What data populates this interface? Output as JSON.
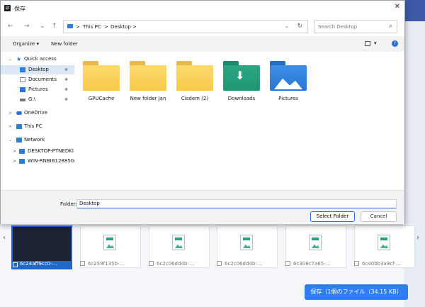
{
  "dialog": {
    "title": "保存",
    "close_glyph": "✕",
    "nav": {
      "back": "←",
      "forward": "→",
      "recent": "⌄",
      "up": "↑"
    },
    "address": {
      "sep1": ">",
      "crumb1": "This PC",
      "sep2": ">",
      "crumb2": "Desktop",
      "sep3": ">",
      "dropdown": "⌄",
      "refresh": "↻"
    },
    "search_placeholder": "Search Desktop",
    "search_icon": "⌕",
    "toolbar": {
      "organize": "Organize ▾",
      "new_folder": "New folder",
      "view_dd": "▾",
      "help": "?"
    },
    "sidebar": [
      {
        "id": "quick-access",
        "chev": "⌄",
        "label": "Quick access",
        "icon": "star-icon"
      },
      {
        "id": "desktop",
        "label": "Desktop",
        "pin": "✱",
        "icon": "desktop-icon"
      },
      {
        "id": "documents",
        "label": "Documents",
        "pin": "✱",
        "icon": "documents-icon"
      },
      {
        "id": "pictures",
        "label": "Pictures",
        "pin": "✱",
        "icon": "pictures-icon"
      },
      {
        "id": "drive",
        "label": "G:\\",
        "pin": "✱",
        "icon": "drive-icon"
      },
      {
        "id": "onedrive",
        "chev": ">",
        "label": "OneDrive",
        "icon": "cloud-icon"
      },
      {
        "id": "thispc",
        "chev": ">",
        "label": "This PC",
        "icon": "pc-icon"
      },
      {
        "id": "network",
        "chev": "⌄",
        "label": "Network",
        "icon": "network-icon"
      },
      {
        "id": "desktop-ptn",
        "chev": ">",
        "label": "DESKTOP-PTNEDKI",
        "icon": "computer-icon"
      },
      {
        "id": "win-rnb",
        "chev": ">",
        "label": "WIN-RNBIB12885G",
        "icon": "computer-icon"
      }
    ],
    "items": [
      {
        "name": "GPUCache",
        "type": "folder"
      },
      {
        "name": "New folder Jan",
        "type": "folder"
      },
      {
        "name": "Cisdem (2)",
        "type": "folder"
      },
      {
        "name": "Downloads",
        "type": "downloads",
        "glyph": "⬇"
      },
      {
        "name": "Pictures",
        "type": "pictures"
      }
    ],
    "footer": {
      "folder_label": "Folder:",
      "folder_value": "Desktop",
      "select_button": "Select Folder",
      "cancel_button": "Cancel"
    }
  },
  "background": {
    "prev_arrow": "‹",
    "next_arrow": "›",
    "thumbnails": [
      {
        "label": "6c24aff9cc0-…",
        "selected": true
      },
      {
        "label": "6c259f135b-…",
        "selected": false
      },
      {
        "label": "6c2c06dd4b-…",
        "selected": false
      },
      {
        "label": "6c2c06dd4b-…",
        "selected": false
      },
      {
        "label": "6c308c7a65-…",
        "selected": false
      },
      {
        "label": "6c40bb3a9cf-…",
        "selected": false
      }
    ],
    "save_button": "保存（1個のファイル（34.15 KB）"
  }
}
